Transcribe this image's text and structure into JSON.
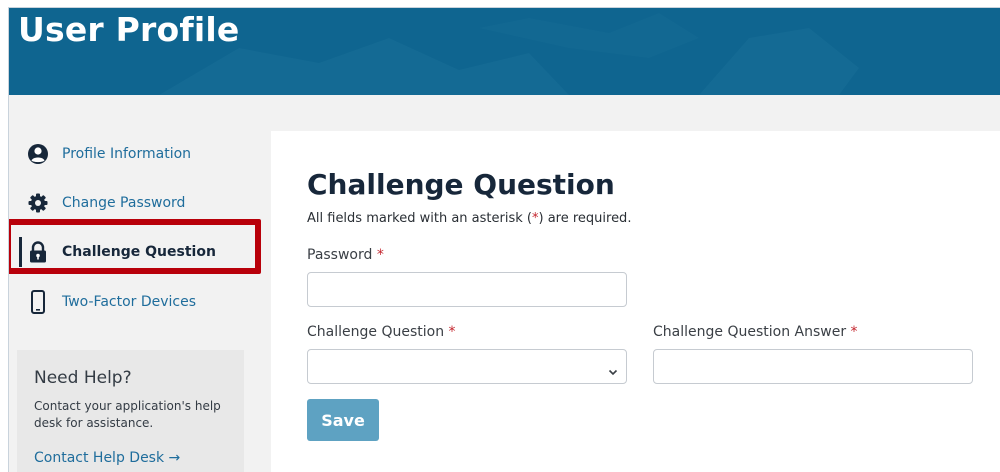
{
  "banner": {
    "title": "User Profile"
  },
  "sidebar": {
    "items": [
      {
        "label": "Profile Information",
        "icon": "user-circle-icon",
        "active": false
      },
      {
        "label": "Change Password",
        "icon": "gear-icon",
        "active": false
      },
      {
        "label": "Challenge Question",
        "icon": "lock-icon",
        "active": true
      },
      {
        "label": "Two-Factor Devices",
        "icon": "mobile-phone-icon",
        "active": false
      }
    ],
    "help": {
      "title": "Need Help?",
      "text": "Contact your application's help desk for assistance.",
      "link": "Contact Help Desk →"
    }
  },
  "main": {
    "title": "Challenge Question",
    "required_note_prefix": "All fields marked with an asterisk (",
    "required_star": "*",
    "required_note_suffix": ") are required.",
    "fields": {
      "password": {
        "label": "Password",
        "value": ""
      },
      "question": {
        "label": "Challenge Question",
        "selected": ""
      },
      "answer": {
        "label": "Challenge Question Answer",
        "value": ""
      }
    },
    "save_label": "Save"
  },
  "colors": {
    "banner": "#0f6590",
    "accent_link": "#1f6d9c",
    "highlight": "#b8000a",
    "button": "#5ea2c2",
    "required": "#c4262e"
  }
}
